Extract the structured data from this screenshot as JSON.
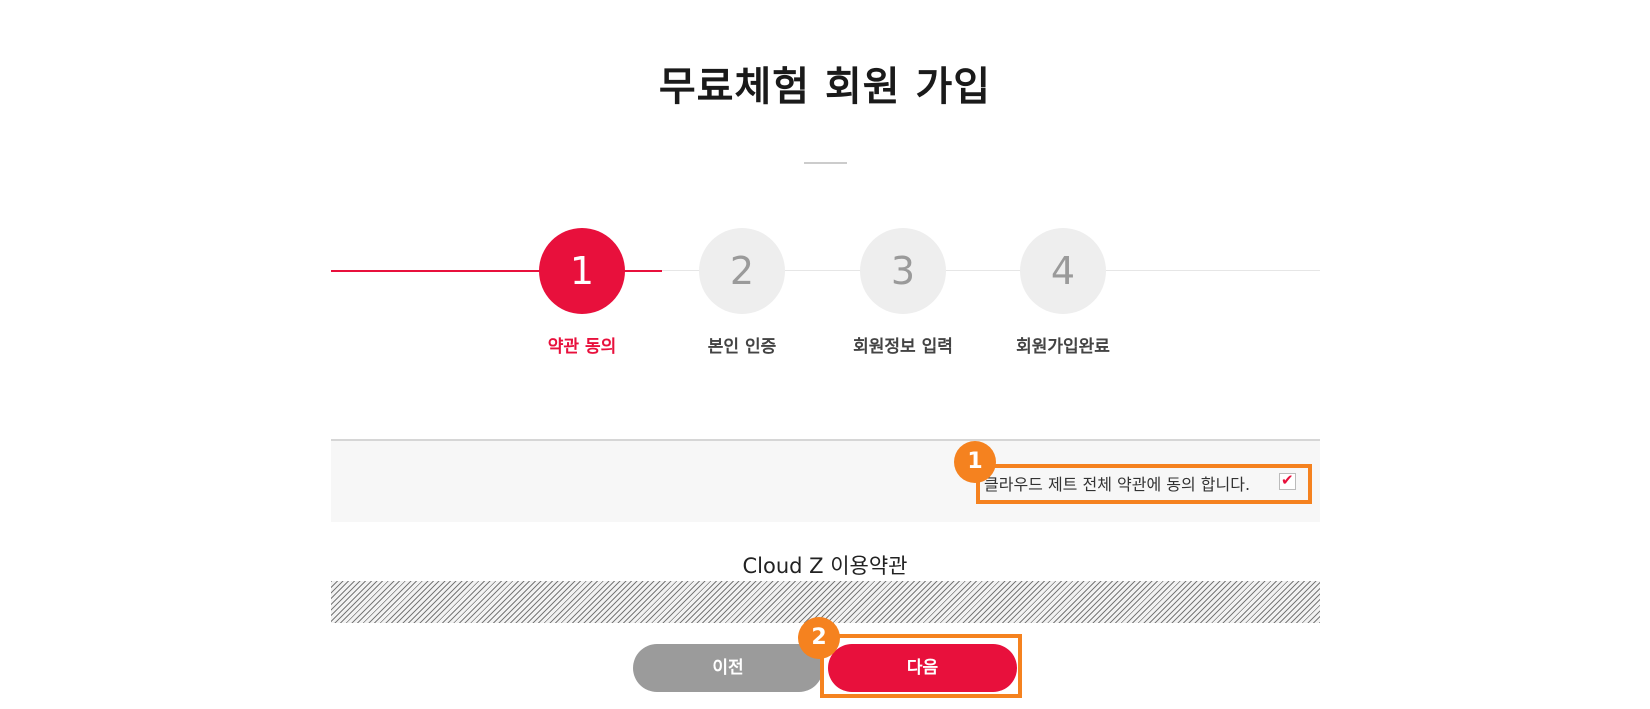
{
  "page": {
    "title": "무료체험 회원 가입"
  },
  "steps": [
    {
      "number": "1",
      "label": "약관 동의",
      "active": true
    },
    {
      "number": "2",
      "label": "본인 인증",
      "active": false
    },
    {
      "number": "3",
      "label": "회원정보 입력",
      "active": false
    },
    {
      "number": "4",
      "label": "회원가입완료",
      "active": false
    }
  ],
  "agreement": {
    "label": "클라우드 제트 전체 약관에 동의 합니다.",
    "checked": true,
    "check_glyph": "✔"
  },
  "terms": {
    "title": "Cloud Z 이용약관"
  },
  "buttons": {
    "prev_label": "이전",
    "next_label": "다음"
  },
  "annotations": {
    "marker_1": "1",
    "marker_2": "2"
  },
  "colors": {
    "accent": "#e8103c",
    "highlight": "#f5821f",
    "inactive_step": "#eeeeee",
    "prev_button": "#9b9b9b"
  }
}
